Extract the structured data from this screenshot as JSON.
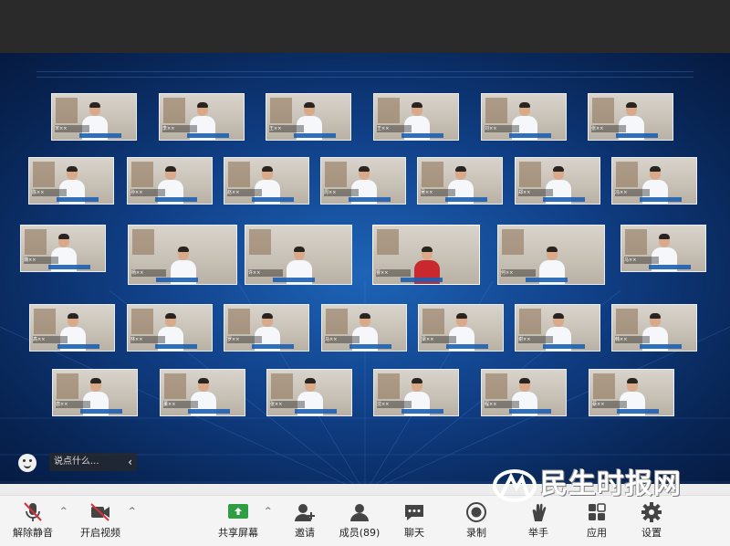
{
  "gallery": {
    "tiles": [
      {
        "name": "宋××"
      },
      {
        "name": "李××"
      },
      {
        "name": "王××"
      },
      {
        "name": "王××"
      },
      {
        "name": "刘××"
      },
      {
        "name": "张××"
      },
      {
        "name": "陈××"
      },
      {
        "name": "孙××"
      },
      {
        "name": "赵××"
      },
      {
        "name": "周××"
      },
      {
        "name": "吴××"
      },
      {
        "name": "郑××"
      },
      {
        "name": "冯××"
      },
      {
        "name": "魏××"
      },
      {
        "name": "杨××"
      },
      {
        "name": "许××"
      },
      {
        "name": "曹××"
      },
      {
        "name": "何××"
      },
      {
        "name": "马××"
      },
      {
        "name": "高××"
      },
      {
        "name": "林××"
      },
      {
        "name": "罗××"
      },
      {
        "name": "马××"
      },
      {
        "name": "梁××"
      },
      {
        "name": "谢××"
      },
      {
        "name": "韩××"
      },
      {
        "name": "唐××"
      },
      {
        "name": "董××"
      },
      {
        "name": "张××"
      },
      {
        "name": "沈××"
      },
      {
        "name": "程××"
      },
      {
        "name": "蔡××"
      }
    ]
  },
  "chat": {
    "placeholder": "说点什么...",
    "send_arrow": "‹"
  },
  "watermark": {
    "text": "民生时报网"
  },
  "toolbar": {
    "unmute": "解除静音",
    "start_video": "开启视频",
    "share_screen": "共享屏幕",
    "invite": "邀请",
    "participants": "成员(89)",
    "chat": "聊天",
    "record": "录制",
    "raise_hand": "举手",
    "apps": "应用",
    "settings": "设置",
    "caret": "^"
  },
  "colors": {
    "accent_green": "#2f9e44",
    "danger_red": "#d9303a",
    "stage_blue": "#103f86"
  }
}
